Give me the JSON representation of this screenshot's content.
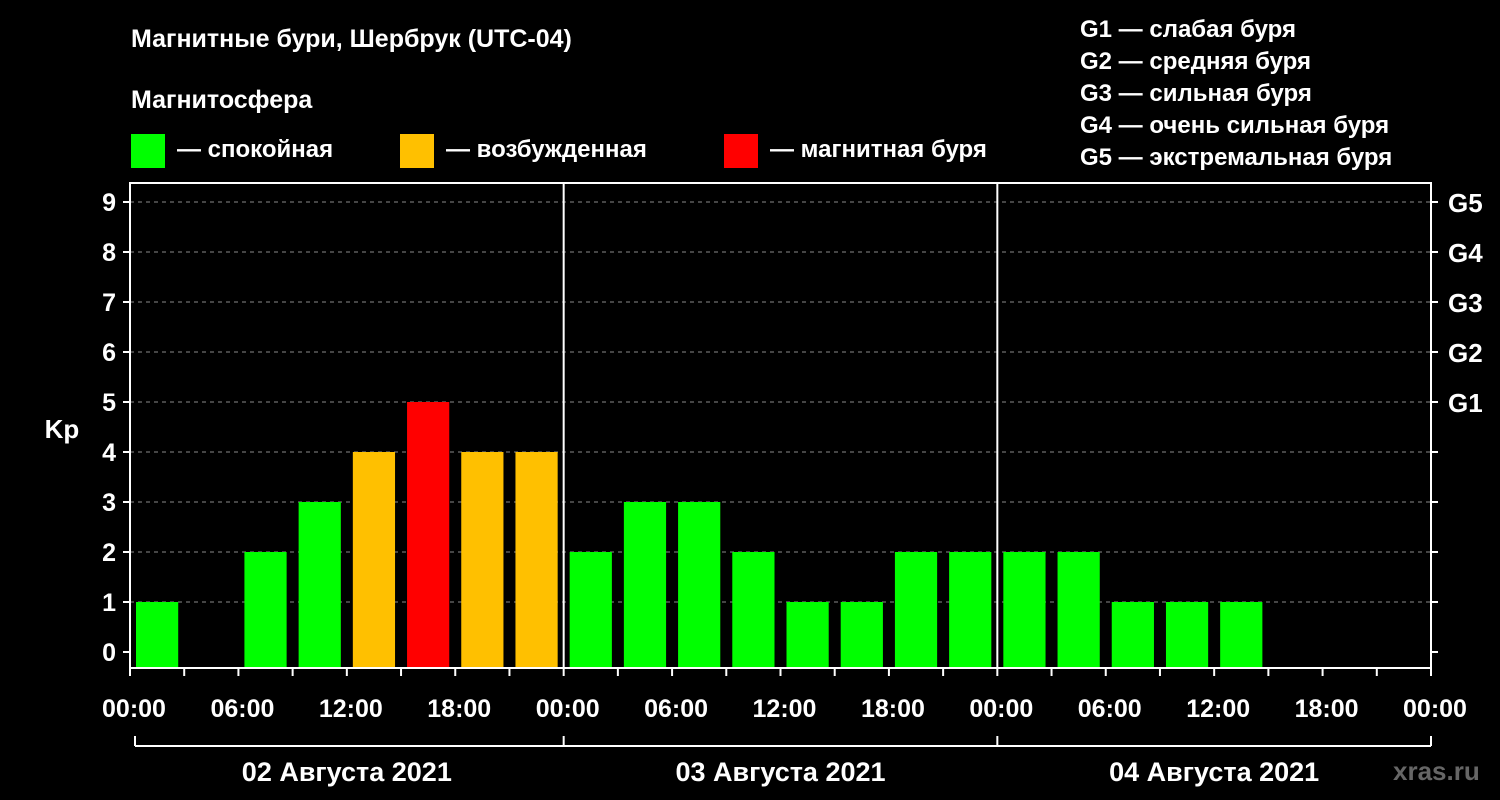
{
  "title": "Магнитные бури, Шербрук (UTC-04)",
  "subtitle": "Магнитосфера",
  "legend": [
    {
      "label": "— спокойная",
      "color": "#00ff00"
    },
    {
      "label": "— возбужденная",
      "color": "#ffc000"
    },
    {
      "label": "— магнитная буря",
      "color": "#ff0000"
    }
  ],
  "storm_levels": [
    "G1 — слабая буря",
    "G2 — средняя буря",
    "G3 — сильная буря",
    "G4 — очень сильная буря",
    "G5 — экстремальная буря"
  ],
  "watermark": "xras.ru",
  "chart_data": {
    "type": "bar",
    "ylabel": "Kp",
    "ylim": [
      0,
      9
    ],
    "yticks": [
      "0",
      "1",
      "2",
      "3",
      "4",
      "5",
      "6",
      "7",
      "8",
      "9"
    ],
    "right_ticks": [
      {
        "value": 5,
        "label": "G1"
      },
      {
        "value": 6,
        "label": "G2"
      },
      {
        "value": 7,
        "label": "G3"
      },
      {
        "value": 8,
        "label": "G4"
      },
      {
        "value": 9,
        "label": "G5"
      }
    ],
    "xticks": [
      "00:00",
      "06:00",
      "12:00",
      "18:00",
      "00:00",
      "06:00",
      "12:00",
      "18:00",
      "00:00",
      "06:00",
      "12:00",
      "18:00",
      "00:00"
    ],
    "days": [
      "02 Августа 2021",
      "03 Августа 2021",
      "04 Августа 2021"
    ],
    "grid": true,
    "values": [
      1,
      null,
      2,
      3,
      4,
      5,
      4,
      4,
      2,
      3,
      3,
      2,
      1,
      1,
      2,
      2,
      2,
      2,
      1,
      1,
      1,
      null,
      null,
      null
    ],
    "colors": {
      "quiet": "#00ff00",
      "unsettled": "#ffc000",
      "storm": "#ff0000"
    }
  }
}
